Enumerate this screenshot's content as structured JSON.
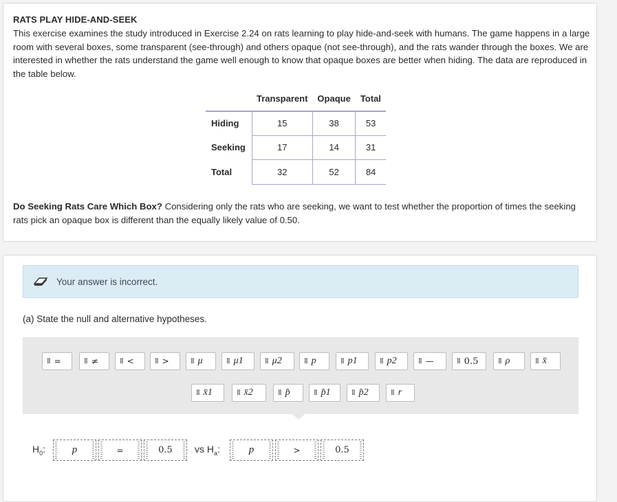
{
  "card1": {
    "title": "RATS PLAY HIDE-AND-SEEK",
    "intro": "This exercise examines the study introduced in Exercise 2.24 on rats learning to play hide-and-seek with humans. The game happens in a large room with several boxes, some transparent (see-through) and others opaque (not see-through), and the rats wander through the boxes. We are interested in whether the rats understand the game well enough to know that opaque boxes are better when hiding. The data are reproduced in the table below.",
    "table": {
      "columns": [
        "Transparent",
        "Opaque",
        "Total"
      ],
      "rows": [
        {
          "label": "Hiding",
          "values": [
            "15",
            "38",
            "53"
          ]
        },
        {
          "label": "Seeking",
          "values": [
            "17",
            "14",
            "31"
          ]
        },
        {
          "label": "Total",
          "values": [
            "32",
            "52",
            "84"
          ]
        }
      ]
    },
    "question_bold": "Do Seeking Rats Care Which Box?",
    "question_rest": " Considering only the rats who are seeking, we want to test whether the proportion of times the seeking rats pick an opaque box is different than the equally likely value of 0.50."
  },
  "card2": {
    "alert_text": "Your answer is incorrect.",
    "alert_icon": "eraser-icon",
    "part_label": "(a) State the null and alternative hypotheses.",
    "tiles_row1": [
      "=",
      "≠",
      "<",
      ">",
      "μ",
      "μ1",
      "μ2",
      "p",
      "p1",
      "p2",
      "—",
      "0.5",
      "ρ",
      "x̄"
    ],
    "tiles_row2": [
      "x̄1",
      "x̄2",
      "p̂",
      "p̂1",
      "p̂2",
      "r"
    ],
    "h0_label": "H",
    "h0_sub": "0",
    "ha_label": "vs H",
    "ha_sub": "a",
    "h0_param": "p",
    "h0_op": "=",
    "h0_value": "0.5",
    "ha_param": "p",
    "ha_op": ">",
    "ha_value": "0.5"
  }
}
